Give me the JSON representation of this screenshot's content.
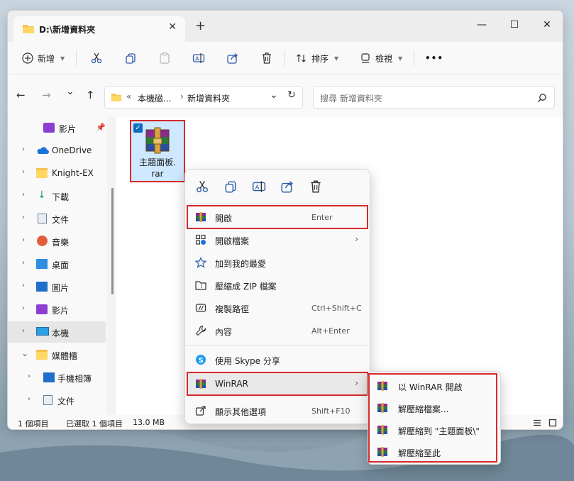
{
  "window": {
    "tab_title": "D:\\新增資料夾",
    "tab_close": "✕",
    "new_tab": "+",
    "minimize": "—",
    "maximize": "☐",
    "close": "✕"
  },
  "toolbar": {
    "new_label": "新增",
    "sort_label": "排序",
    "view_label": "檢視",
    "more": "•••",
    "icons": [
      "cut-icon",
      "copy-icon",
      "paste-icon",
      "rename-icon",
      "share-icon",
      "delete-icon"
    ]
  },
  "nav": {
    "back": "←",
    "forward": "→",
    "recent": "⌄",
    "up": "↑",
    "address_prefix": "«",
    "address_part1": "本機磁...",
    "address_sep": "›",
    "address_part2": "新增資料夾",
    "address_dropdown": "⌄",
    "refresh": "↻",
    "search_placeholder": "搜尋 新增資料夾"
  },
  "sidebar": {
    "items": [
      {
        "label": "影片",
        "icon": "video-icon",
        "pinned": true
      },
      {
        "label": "OneDrive",
        "icon": "cloud-icon"
      },
      {
        "label": "Knight-EX",
        "icon": "folder-icon"
      },
      {
        "label": "下載",
        "icon": "download-icon"
      },
      {
        "label": "文件",
        "icon": "document-icon"
      },
      {
        "label": "音樂",
        "icon": "music-icon"
      },
      {
        "label": "桌面",
        "icon": "desktop-icon"
      },
      {
        "label": "圖片",
        "icon": "picture-icon"
      },
      {
        "label": "影片",
        "icon": "video-icon"
      },
      {
        "label": "本機",
        "icon": "computer-icon"
      },
      {
        "label": "媒體櫃",
        "icon": "library-icon"
      },
      {
        "label": "手機相簿",
        "icon": "phone-album-icon"
      },
      {
        "label": "文件",
        "icon": "document-icon"
      }
    ]
  },
  "file": {
    "name_line1": "主題面板.",
    "name_line2": "rar",
    "checked": "✓"
  },
  "status": {
    "count": "1 個項目",
    "selected": "已選取 1 個項目",
    "size": "13.0 MB"
  },
  "context_menu": {
    "items": [
      {
        "label": "開啟",
        "key": "Enter"
      },
      {
        "label": "開啟檔案",
        "arrow": "›"
      },
      {
        "label": "加到我的最愛"
      },
      {
        "label": "壓縮成 ZIP 檔案"
      },
      {
        "label": "複製路徑",
        "key": "Ctrl+Shift+C"
      },
      {
        "label": "內容",
        "key": "Alt+Enter"
      },
      {
        "label": "使用 Skype 分享"
      },
      {
        "label": "WinRAR",
        "arrow": "›"
      },
      {
        "label": "顯示其他選項",
        "key": "Shift+F10"
      }
    ]
  },
  "winrar_submenu": {
    "items": [
      {
        "label": "以 WinRAR 開啟"
      },
      {
        "label": "解壓縮檔案..."
      },
      {
        "label": "解壓縮到 \"主題面板\\\""
      },
      {
        "label": "解壓縮至此"
      }
    ]
  },
  "colors": {
    "accent": "#0f6cbd",
    "highlight_box": "#d62a2a",
    "selection": "#cde8ff"
  }
}
